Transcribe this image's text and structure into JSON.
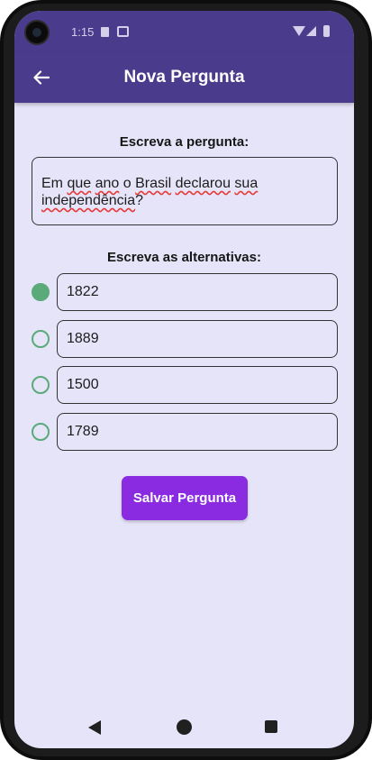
{
  "status_bar": {
    "time": "1:15"
  },
  "app_bar": {
    "title": "Nova Pergunta",
    "back_icon": "arrow-left-icon"
  },
  "question": {
    "label": "Escreva a pergunta:",
    "words": [
      {
        "text": "Em",
        "spell": false
      },
      {
        "text": "que",
        "spell": true
      },
      {
        "text": "ano",
        "spell": true
      },
      {
        "text": "o",
        "spell": false
      },
      {
        "text": "Brasil",
        "spell": true
      },
      {
        "text": "declarou",
        "spell": true
      },
      {
        "text": "sua",
        "spell": true
      },
      {
        "text": "independência",
        "spell": true
      }
    ],
    "ending": "?"
  },
  "alternatives": {
    "label": "Escreva as alternativas:",
    "items": [
      {
        "value": "1822",
        "selected": true
      },
      {
        "value": "1889",
        "selected": false
      },
      {
        "value": "1500",
        "selected": false
      },
      {
        "value": "1789",
        "selected": false
      }
    ]
  },
  "save_button": {
    "label": "Salvar Pergunta"
  },
  "colors": {
    "app_bar": "#4b3b8c",
    "background": "#e6e4f8",
    "radio": "#5aaa7a",
    "button": "#8a2be2",
    "spellcheck": "#e53935"
  },
  "nav_bar": {
    "icons": [
      "nav-back-icon",
      "nav-home-icon",
      "nav-recents-icon"
    ]
  }
}
